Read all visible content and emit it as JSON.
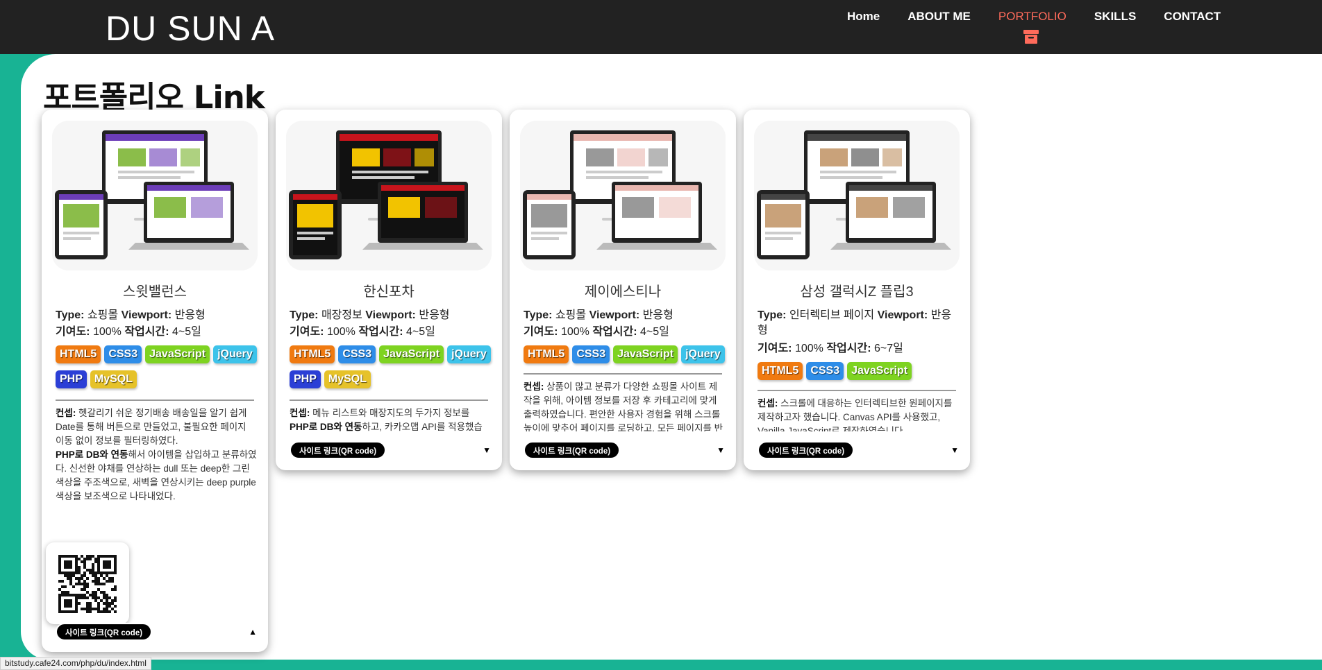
{
  "header": {
    "logo": "DU SUN A",
    "nav": [
      {
        "label": "Home"
      },
      {
        "label": "ABOUT ME"
      },
      {
        "label": "PORTFOLIO"
      },
      {
        "label": "SKILLS"
      },
      {
        "label": "CONTACT"
      }
    ],
    "active_color": "#ff6b5b"
  },
  "page_title": "포트폴리오 Link",
  "cards": [
    {
      "name": "스윗밸런스",
      "type_label": "Type:",
      "type": "쇼핑몰",
      "viewport_label": "Viewport:",
      "viewport": "반응형",
      "contrib_label": "기여도:",
      "contrib": "100%",
      "time_label": "작업시간:",
      "time": "4~5일",
      "tags": [
        "HTML5",
        "CSS3",
        "JavaScript",
        "jQuery",
        "PHP",
        "MySQL"
      ],
      "desc_label": "컨셉:",
      "desc1": "헷갈리기 쉬운 정기배송 배송일을 알기 쉽게 Date를 통해 버튼으로 만들었고, 불필요한 페이지 이동 없이 정보를 필터링하였다.",
      "desc_bold2": "PHP로 DB와 연동",
      "desc2": "해서 아이템을 삽입하고 분류하였다. 신선한 야채를 연상하는 dull 또는 deep한 그린 색상을 주조색으로, 새벽을 연상시키는 deep purple 색상을 보조색으로 나타내었다.",
      "link_label": "사이트 링크(QR code)",
      "arrow": "▲",
      "expanded": true
    },
    {
      "name": "한신포차",
      "type_label": "Type:",
      "type": "매장정보",
      "viewport_label": "Viewport:",
      "viewport": "반응형",
      "contrib_label": "기여도:",
      "contrib": "100%",
      "time_label": "작업시간:",
      "time": "4~5일",
      "tags": [
        "HTML5",
        "CSS3",
        "JavaScript",
        "jQuery",
        "PHP",
        "MySQL"
      ],
      "desc_label": "컨셉:",
      "desc1": "메뉴 리스트와 매장지도의 두가지 정보를",
      "desc_bold2": "PHP로 DB와 연동",
      "desc2": "하고, 카카오맵 API를 적용했습니다. 지역검색으로 매장의 위치를 직접 알 수",
      "link_label": "사이트 링크(QR code)",
      "arrow": "▼",
      "expanded": false
    },
    {
      "name": "제이에스티나",
      "type_label": "Type:",
      "type": "쇼핑몰",
      "viewport_label": "Viewport:",
      "viewport": "반응형",
      "contrib_label": "기여도:",
      "contrib": "100%",
      "time_label": "작업시간:",
      "time": "4~5일",
      "tags": [
        "HTML5",
        "CSS3",
        "JavaScript",
        "jQuery"
      ],
      "desc_label": "컨셉:",
      "desc1": "상품이 많고 분류가 다양한 쇼핑몰 사이트 제작을 위해, 아이템 정보를 저장 후 카테고리에 맞게 출력하였습니다. 편안한 사용자 경험을 위해 스크롤 높이에 맞추어 페이지를 로딩하고, 모든 페이지를 반응형으로 제작하였습니다.",
      "desc_bold2": "",
      "desc2": "",
      "link_label": "사이트 링크(QR code)",
      "arrow": "▼",
      "expanded": false
    },
    {
      "name": "삼성 갤럭시Z 플립3",
      "type_label": "Type:",
      "type": "인터렉티브 페이지",
      "viewport_label": "Viewport:",
      "viewport": "반응형",
      "contrib_label": "기여도:",
      "contrib": "100%",
      "time_label": "작업시간:",
      "time": "6~7일",
      "tags": [
        "HTML5",
        "CSS3",
        "JavaScript"
      ],
      "desc_label": "컨셉:",
      "desc1": "스크롤에 대응하는 인터렉티브한 원페이지를 제작하고자 했습니다. Canvas API를 사용했고, Vanilla JavaScript로 제작하였습니다.",
      "desc_bold2": "",
      "desc2": "",
      "link_label": "사이트 링크(QR code)",
      "arrow": "▼",
      "expanded": false
    }
  ],
  "tag_colors": {
    "HTML5": "#f07a10",
    "CSS3": "#2e8de8",
    "JavaScript": "#7ed321",
    "jQuery": "#3dc3ea",
    "PHP": "#2b3fd6",
    "MySQL": "#e6c229"
  },
  "status_url": "bitstudy.cafe24.com/php/du/index.html"
}
